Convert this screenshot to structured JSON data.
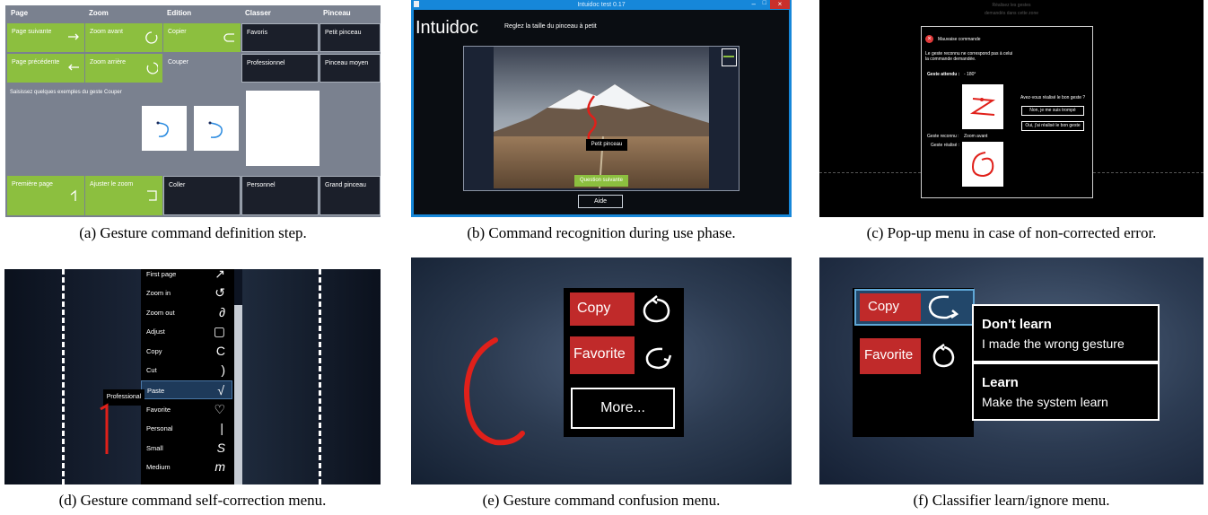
{
  "captions": {
    "a": "(a) Gesture command definition step.",
    "b": "(b) Command recognition during use phase.",
    "c": "(c) Pop-up menu in case of non-corrected error.",
    "d": "(d) Gesture command self-correction menu.",
    "e": "(e) Gesture command confusion menu.",
    "f": "(f) Classifier learn/ignore menu."
  },
  "panel_a": {
    "headers": [
      "Page",
      "Zoom",
      "Edition",
      "Classer",
      "Pinceau"
    ],
    "row1": [
      "Page suivante",
      "Zoom avant",
      "Copier",
      "Favoris",
      "Petit pinceau"
    ],
    "row2": [
      "Page précédente",
      "Zoom arrière",
      "Couper",
      "Professionnel",
      "Pinceau moyen"
    ],
    "row3": [
      "Première page",
      "Ajuster le zoom",
      "Coller",
      "Personnel",
      "Grand pinceau"
    ],
    "instruction": "Saisissez quelques exemples du geste Couper",
    "colors": {
      "green": "#8cbf3f",
      "panel": "#7a818f",
      "dark_tile": "#1b1f2a"
    }
  },
  "panel_b": {
    "window_title": "Intuidoc test 0.17",
    "app_name": "Intuidoc",
    "instruction": "Reglez la taille du pinceau à petit",
    "label": "Petit pinceau",
    "next_button": "Question suivante",
    "help_button": "Aide"
  },
  "panel_c": {
    "top_text_1": "Réalisez les gestes",
    "top_text_2": "demandés dans cette zone",
    "title": "Mauvaise commande",
    "message_1": "Le geste reconnu ne correspond pas à celui",
    "message_2": "la commande demandée.",
    "expected_label": "Geste attendu :",
    "expected_value": "- 180°",
    "question": "Avez-vous réalisé le bon geste ?",
    "button_no": "Non, je me suis trompé",
    "button_yes": "Oui, j'ai réalisé le bon geste",
    "recognized_label": "Geste reconnu :",
    "recognized_value": "Zoom avant",
    "performed_label": "Geste réalisé :"
  },
  "panel_d": {
    "items": [
      {
        "label": "First page",
        "glyph": "↗"
      },
      {
        "label": "Zoom in",
        "glyph": "↺"
      },
      {
        "label": "Zoom out",
        "glyph": "∂"
      },
      {
        "label": "Adjust",
        "glyph": "▢"
      },
      {
        "label": "Copy",
        "glyph": "C"
      },
      {
        "label": "Cut",
        "glyph": ")"
      },
      {
        "label": "Paste",
        "glyph": "√"
      },
      {
        "label": "Favorite",
        "glyph": "♡"
      },
      {
        "label": "Personal",
        "glyph": "|"
      },
      {
        "label": "Small",
        "glyph": "S"
      },
      {
        "label": "Medium",
        "glyph": "m"
      }
    ],
    "tooltip": "Professional"
  },
  "panel_e": {
    "copy": "Copy",
    "favorite": "Favorite",
    "more": "More..."
  },
  "panel_f": {
    "copy": "Copy",
    "favorite": "Favorite",
    "dont_learn_title": "Don't learn",
    "dont_learn_sub": "I made the wrong gesture",
    "learn_title": "Learn",
    "learn_sub": "Make the system learn"
  }
}
